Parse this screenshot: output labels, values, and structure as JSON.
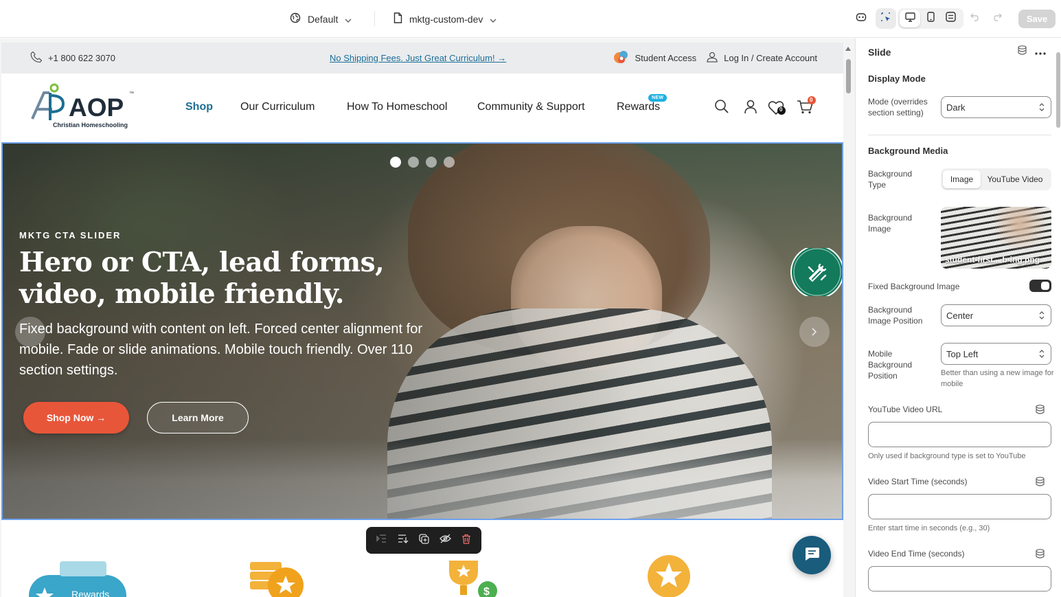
{
  "editor": {
    "theme_label": "Default",
    "template_label": "mktg-custom-dev",
    "save_label": "Save"
  },
  "site": {
    "utility": {
      "phone": "+1 800 622 3070",
      "promo": "No Shipping Fees. Just Great Curriculum! →",
      "student_access": "Student Access",
      "login": "Log In / Create Account"
    },
    "logo": {
      "text": "AOP",
      "tm": "™",
      "tagline": "Christian Homeschooling"
    },
    "nav": {
      "items": [
        "Shop",
        "Our Curriculum",
        "How To Homeschool",
        "Community & Support",
        "Rewards"
      ],
      "active_index": 0,
      "new_badge": "NEW",
      "wishlist_count": "0",
      "cart_count": "0"
    },
    "hero": {
      "eyebrow": "MKTG CTA SLIDER",
      "title": "Hero or CTA, lead forms, video, mobile friendly.",
      "description": "Fixed background with content on left. Forced center alignment for mobile. Fade or slide animations. Mobile touch friendly. Over 110 section settings.",
      "primary_cta": "Shop Now →",
      "secondary_cta": "Learn More",
      "slide_count": 4,
      "active_slide": 0
    },
    "features": {
      "rewards_label": "Rewards"
    }
  },
  "panel": {
    "title": "Slide",
    "display_mode": {
      "heading": "Display Mode",
      "mode_label": "Mode (overrides section setting)",
      "mode_value": "Dark"
    },
    "background_media": {
      "heading": "Background Media",
      "type_label": "Background Type",
      "type_options": [
        "Image",
        "YouTube Video"
      ],
      "type_selected": "Image",
      "image_label": "Background Image",
      "image_filename": "student-first... b-ing.png",
      "fixed_label": "Fixed Background Image",
      "fixed_on": true,
      "position_label": "Background Image Position",
      "position_value": "Center",
      "mobile_position_label": "Mobile Background Position",
      "mobile_position_value": "Top Left",
      "mobile_position_hint": "Better than using a new image for mobile",
      "youtube_label": "YouTube Video URL",
      "youtube_hint": "Only used if background type is set to YouTube",
      "start_label": "Video Start Time (seconds)",
      "start_hint": "Enter start time in seconds (e.g., 30)",
      "end_label": "Video End Time (seconds)"
    }
  },
  "colors": {
    "accent_link": "#1c6e93",
    "cta_orange": "#e8563a",
    "selection_outline": "#6ea1ee",
    "chat_fab": "#1a5c7c",
    "tools_badge": "#137a5b"
  }
}
